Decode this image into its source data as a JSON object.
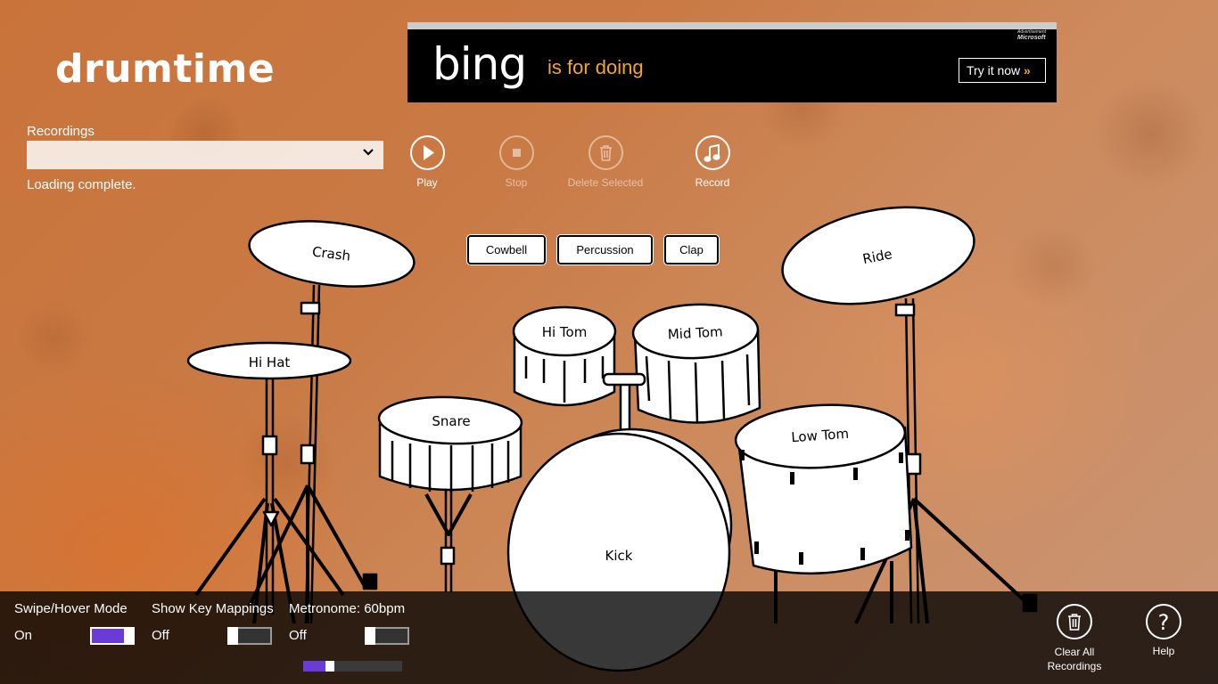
{
  "app": {
    "title": "drumtime"
  },
  "ad": {
    "badge_top": "Advertisement",
    "badge": "Microsoft",
    "brand": "bing",
    "tagline": "is for doing",
    "cta": "Try it now",
    "cta_arrow": "»"
  },
  "recordings": {
    "label": "Recordings",
    "selected": "",
    "status": "Loading complete."
  },
  "toolbar": {
    "play": "Play",
    "stop": "Stop",
    "delete": "Delete Selected",
    "record": "Record"
  },
  "percussion": {
    "cowbell": "Cowbell",
    "percussion": "Percussion",
    "clap": "Clap"
  },
  "kit": {
    "crash": "Crash",
    "hihat": "Hi Hat",
    "snare": "Snare",
    "hitom": "Hi Tom",
    "midtom": "Mid Tom",
    "lowtom": "Low Tom",
    "kick": "Kick",
    "ride": "Ride"
  },
  "settings": {
    "swipe": {
      "label": "Swipe/Hover Mode",
      "state": "On"
    },
    "keymap": {
      "label": "Show Key Mappings",
      "state": "Off"
    },
    "metronome": {
      "label": "Metronome: 60bpm",
      "state": "Off",
      "tempo_fraction": 0.25
    }
  },
  "actions": {
    "clear_all": "Clear All\nRecordings",
    "help": "Help"
  },
  "colors": {
    "accent": "#6a3bd6",
    "ad_orange": "#f5a623"
  }
}
